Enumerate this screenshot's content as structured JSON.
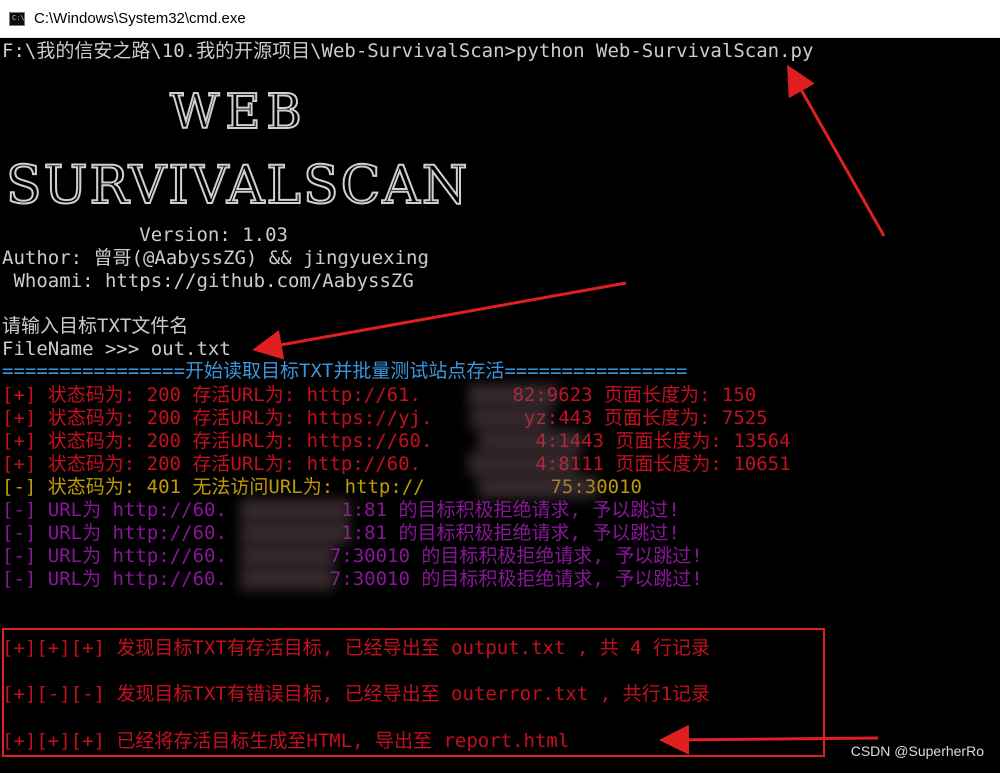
{
  "window": {
    "title": "C:\\Windows\\System32\\cmd.exe",
    "icon": "cmd-icon",
    "icon_text": "C:\\"
  },
  "prompt": {
    "command": "F:\\我的信安之路\\10.我的开源项目\\Web-SurvivalScan>python Web-SurvivalScan.py"
  },
  "banner": {
    "logo_line1": "WEB",
    "logo_line2": "SURVIVALSCAN",
    "version": "            Version: 1.03",
    "author": "Author: 曾哥(@AabyssZG) && jingyuexing",
    "whoami": " Whoami: https://github.com/AabyssZG"
  },
  "input": {
    "prompt_label": "请输入目标TXT文件名",
    "filename_line": "FileName >>> out.txt"
  },
  "separator": "================开始读取目标TXT并批量测试站点存活================",
  "results": [
    {
      "text": "[+] 状态码为: 200 存活URL为: http://61.        82:9623 页面长度为: 150",
      "color": "red"
    },
    {
      "text": "[+] 状态码为: 200 存活URL为: https://yj.        yz:443 页面长度为: 7525",
      "color": "red"
    },
    {
      "text": "[+] 状态码为: 200 存活URL为: https://60.         4:1443 页面长度为: 13564",
      "color": "red"
    },
    {
      "text": "[+] 状态码为: 200 存活URL为: http://60.          4:8111 页面长度为: 10651",
      "color": "red"
    },
    {
      "text": "[-] 状态码为: 401 无法访问URL为: http://           75:30010",
      "color": "yellow"
    },
    {
      "text": "[-] URL为 http://60.          1:81 的目标积极拒绝请求, 予以跳过!",
      "color": "purple"
    },
    {
      "text": "[-] URL为 http://60.          1:81 的目标积极拒绝请求, 予以跳过!",
      "color": "purple"
    },
    {
      "text": "[-] URL为 http://60.         7:30010 的目标积极拒绝请求, 予以跳过!",
      "color": "purple"
    },
    {
      "text": "[-] URL为 http://60.         7:30010 的目标积极拒绝请求, 予以跳过!",
      "color": "purple"
    }
  ],
  "summary": [
    "[+][+][+] 发现目标TXT有存活目标, 已经导出至 output.txt , 共 4 行记录",
    "[+][-][-] 发现目标TXT有错误目标, 已经导出至 outerror.txt , 共行1记录",
    "[+][+][+] 已经将存活目标生成至HTML, 导出至 report.html"
  ],
  "watermark": "CSDN @SuperherRo",
  "colors": {
    "terminal_bg": "#000000",
    "default_text": "#cccccc",
    "blue": "#3a96dd",
    "red": "#c50f1f",
    "yellow": "#c19c00",
    "purple": "#881798",
    "annotation_red": "#e02020"
  }
}
